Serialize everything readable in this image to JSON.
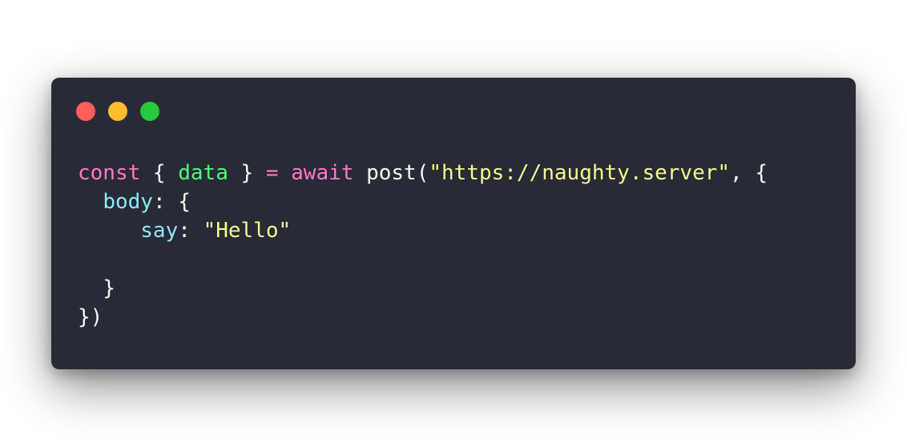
{
  "window": {
    "background": "#282a36",
    "buttons": [
      {
        "name": "close",
        "color": "#ff5f56"
      },
      {
        "name": "minimize",
        "color": "#ffbd2e"
      },
      {
        "name": "maximize",
        "color": "#27c93f"
      }
    ]
  },
  "code": {
    "colors": {
      "keyword": "#ff79c6",
      "plain": "#f8f8f2",
      "variable": "#50fa7b",
      "string": "#f1fa8c",
      "property": "#8be9fd"
    },
    "lines": [
      [
        {
          "text": "const",
          "type": "keyword"
        },
        {
          "text": " { ",
          "type": "plain"
        },
        {
          "text": "data",
          "type": "variable"
        },
        {
          "text": " } ",
          "type": "plain"
        },
        {
          "text": "=",
          "type": "keyword"
        },
        {
          "text": " ",
          "type": "plain"
        },
        {
          "text": "await",
          "type": "keyword"
        },
        {
          "text": " post(",
          "type": "plain"
        },
        {
          "text": "\"https://naughty.server\"",
          "type": "string"
        },
        {
          "text": ", {",
          "type": "plain"
        }
      ],
      [
        {
          "text": "  ",
          "type": "plain"
        },
        {
          "text": "body",
          "type": "property"
        },
        {
          "text": ": {",
          "type": "plain"
        }
      ],
      [
        {
          "text": "     ",
          "type": "plain"
        },
        {
          "text": "say",
          "type": "property"
        },
        {
          "text": ": ",
          "type": "plain"
        },
        {
          "text": "\"Hello\"",
          "type": "string"
        }
      ],
      [],
      [
        {
          "text": "  }",
          "type": "plain"
        }
      ],
      [
        {
          "text": "})",
          "type": "plain"
        }
      ]
    ]
  }
}
